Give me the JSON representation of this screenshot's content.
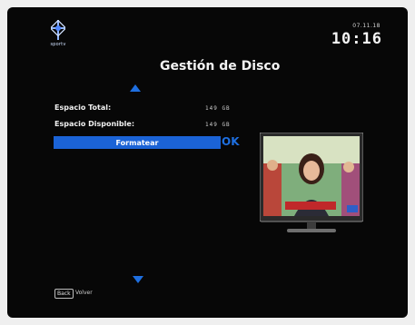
{
  "header": {
    "logo_text": "sportv",
    "date": "07.11.18",
    "time": "10:16"
  },
  "page_title": "Gestión de Disco",
  "disk_info": {
    "total_label": "Espacio Total:",
    "total_value": "149 GB",
    "available_label": "Espacio Disponible:",
    "available_value": "149 GB"
  },
  "actions": {
    "format_label": "Formatear",
    "ok_label": "OK"
  },
  "footer": {
    "back_key": "Back",
    "back_label": "Volver"
  },
  "colors": {
    "accent": "#1b63d6",
    "background": "#070707"
  },
  "icons": [
    "logo-icon",
    "arrow-up-icon",
    "arrow-down-icon",
    "tv-preview-icon"
  ]
}
